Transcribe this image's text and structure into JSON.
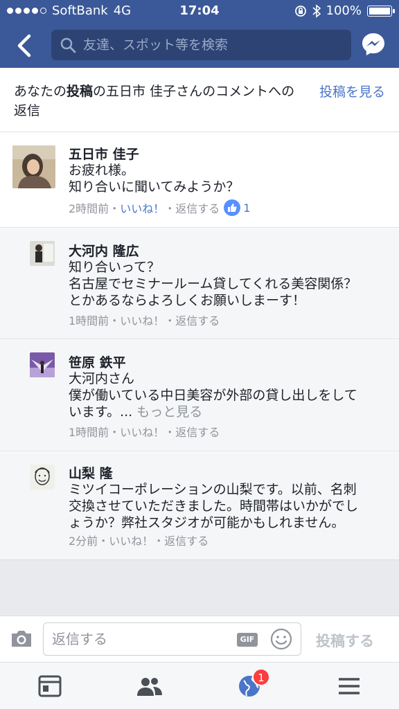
{
  "status_bar": {
    "carrier": "SoftBank",
    "network": "4G",
    "time": "17:04",
    "battery": "100%"
  },
  "header": {
    "search_placeholder": "友達、スポット等を検索"
  },
  "context": {
    "prefix": "あなたの",
    "bold": "投稿",
    "suffix": "の五日市 佳子さんのコメントへの返信",
    "view_post": "投稿を見る"
  },
  "main_comment": {
    "author": "五日市 佳子",
    "lines": [
      "お疲れ様。",
      "知り合いに聞いてみようか？"
    ],
    "time": "2時間前",
    "like": "いいね！",
    "reply": "返信する",
    "like_count": "1"
  },
  "replies": [
    {
      "author": "大河内 隆広",
      "lines": [
        "知り合いって？",
        "名古屋でセミナールーム貸してくれる美容関係？",
        "とかあるならよろしくお願いしまーす！"
      ],
      "time": "1時間前",
      "like": "いいね！",
      "reply": "返信する"
    },
    {
      "author": "笹原 鉄平",
      "lines": [
        "大河内さん",
        "僕が働いている中日美容が外部の貸し出しをして",
        "います。..."
      ],
      "more": "もっと見る",
      "time": "1時間前",
      "like": "いいね！",
      "reply": "返信する"
    },
    {
      "author": "山梨 隆",
      "lines": [
        "ミツイコーポレーションの山梨です。以前、名刺",
        "交換させていただきました。時間帯はいかがでし",
        "ょうか？弊社スタジオが可能かもしれません。"
      ],
      "time": "2分前",
      "like": "いいね！",
      "reply": "返信する"
    }
  ],
  "compose": {
    "placeholder": "返信する",
    "gif_label": "GIF",
    "post_label": "投稿する"
  },
  "tabbar": {
    "notifications_badge": "1"
  },
  "colors": {
    "brand": "#3b5998",
    "link": "#4a76c8",
    "badge": "#fa3e3e"
  }
}
